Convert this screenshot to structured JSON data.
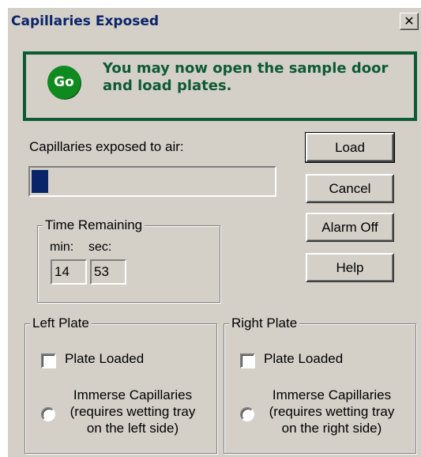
{
  "window": {
    "title": "Capillaries Exposed",
    "close_glyph": "✕"
  },
  "banner": {
    "icon_text": "Go",
    "message_line1": "You may now open the sample door",
    "message_line2": "and load plates.",
    "border_color": "#0e5a34",
    "icon_color": "#0e8a1f"
  },
  "exposure": {
    "label": "Capillaries exposed to air:",
    "progress_percent": 7
  },
  "buttons": {
    "load": "Load",
    "cancel": "Cancel",
    "alarm_off": "Alarm Off",
    "help": "Help"
  },
  "time_remaining": {
    "title": "Time Remaining",
    "min_label": "min:",
    "sec_label": "sec:",
    "min_value": "14",
    "sec_value": "53"
  },
  "left_plate": {
    "title": "Left Plate",
    "checkbox_label": "Plate Loaded",
    "checked": false,
    "radio_line1": "Immerse Capillaries",
    "radio_line2": "(requires wetting tray",
    "radio_line3": "on the left side)"
  },
  "right_plate": {
    "title": "Right Plate",
    "checkbox_label": "Plate Loaded",
    "checked": false,
    "radio_line1": "Immerse Capillaries",
    "radio_line2": "(requires wetting tray",
    "radio_line3": "on the right side)"
  },
  "colors": {
    "face": "#d4d0c8",
    "title_text": "#0a246a",
    "progress_fill": "#0a246a"
  }
}
